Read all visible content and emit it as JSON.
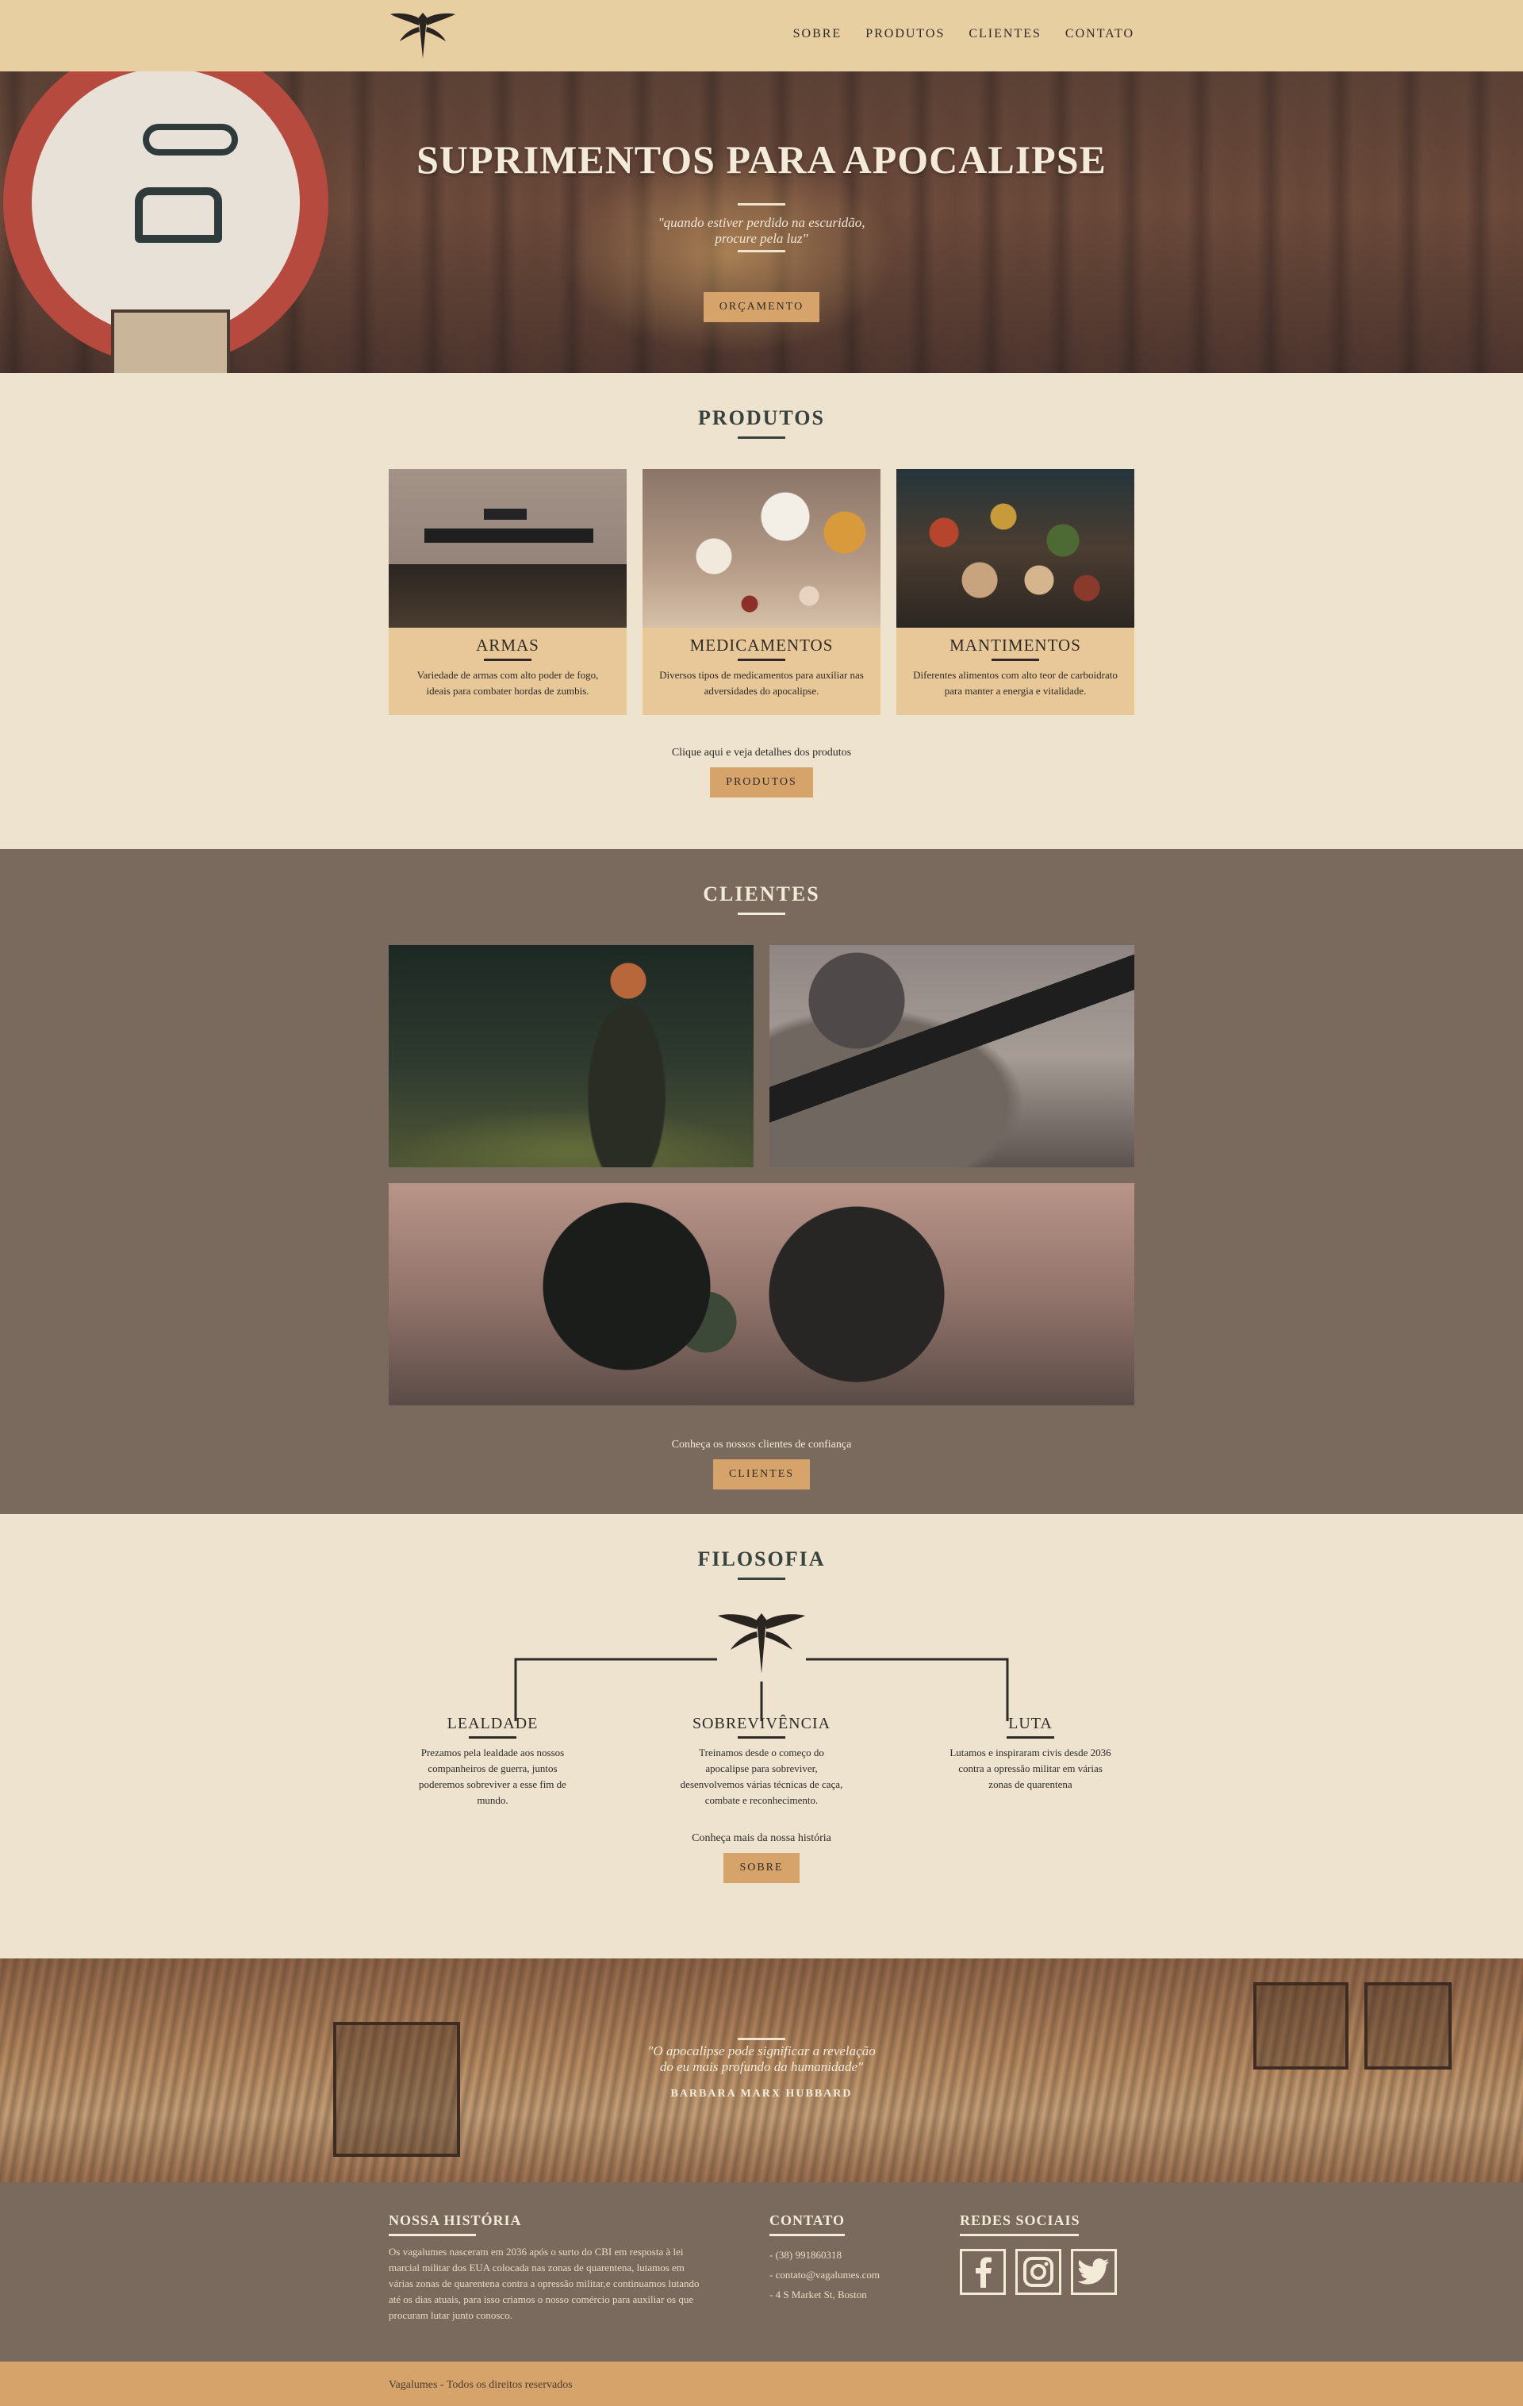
{
  "nav": {
    "items": [
      "SOBRE",
      "PRODUTOS",
      "CLIENTES",
      "CONTATO"
    ]
  },
  "hero": {
    "title": "SUPRIMENTOS PARA APOCALIPSE",
    "quote_line1": "\"quando estiver perdido na escuridão,",
    "quote_line2": "procure pela luz\"",
    "button": "ORÇAMENTO"
  },
  "produtos": {
    "title": "PRODUTOS",
    "cards": [
      {
        "title": "ARMAS",
        "text": "Variedade de armas com alto poder de fogo, ideais para combater hordas de zumbis."
      },
      {
        "title": "MEDICAMENTOS",
        "text": "Diversos tipos de medicamentos para auxiliar nas adversidades do apocalipse."
      },
      {
        "title": "MANTIMENTOS",
        "text": "Diferentes alimentos com alto teor de carboidrato para manter a energia e vitalidade."
      }
    ],
    "cta": "Clique aqui e veja detalhes dos produtos",
    "button": "PRODUTOS"
  },
  "clientes": {
    "title": "CLIENTES",
    "cta": "Conheça os nossos clientes de confiança",
    "button": "CLIENTES"
  },
  "filosofia": {
    "title": "FILOSOFIA",
    "pillars": [
      {
        "title": "LEALDADE",
        "text": "Prezamos pela lealdade aos nossos companheiros de guerra, juntos poderemos sobreviver a esse fim de mundo."
      },
      {
        "title": "SOBREVIVÊNCIA",
        "text": "Treinamos desde o começo do apocalipse para sobreviver, desenvolvemos várias técnicas de caça, combate e reconhecimento."
      },
      {
        "title": "LUTA",
        "text": "Lutamos e inspiraram civis desde 2036 contra a opressão militar em várias zonas de quarentena"
      }
    ],
    "cta": "Conheça mais da nossa história",
    "button": "SOBRE"
  },
  "quote": {
    "line1": "\"O apocalipse pode significar a revelação",
    "line2": "do eu mais profundo da humanidade\"",
    "author": "BARBARA MARX HUBBARD"
  },
  "footer": {
    "historia_title": "NOSSA HISTÓRIA",
    "historia_text": "Os vagalumes nasceram em 2036 após o surto do CBI em resposta à lei marcial militar dos EUA colocada nas zonas de quarentena, lutamos em várias zonas de quarentena contra a opressão militar,e continuamos lutando até os dias atuais, para isso criamos o nosso comércio para auxiliar os que procuram lutar junto conosco.",
    "contato_title": "CONTATO",
    "contato_items": [
      "- (38) 991860318",
      "- contato@vagalumes.com",
      "- 4 S Market St, Boston"
    ],
    "redes_title": "REDES SOCIAIS",
    "social_icons": [
      "facebook-icon",
      "instagram-icon",
      "twitter-icon"
    ]
  },
  "copyright": "Vagalumes - Todos os direitos reservados",
  "colors": {
    "header_bg": "#e8cfa2",
    "page_bg": "#ede3cf",
    "dark_section_bg": "#7a695d",
    "button_bg": "#d6a46a",
    "title_color": "#38423f"
  }
}
